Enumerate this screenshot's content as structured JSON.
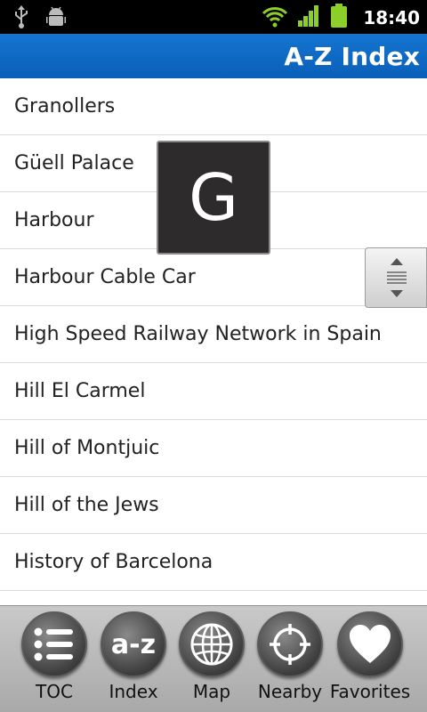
{
  "status_bar": {
    "time": "18:40",
    "icons": [
      "usb-icon",
      "android-debug-icon",
      "wifi-icon",
      "signal-icon",
      "battery-icon"
    ]
  },
  "title_bar": {
    "title": "A-Z Index"
  },
  "list": {
    "items": [
      "Granollers",
      "Güell Palace",
      "Harbour",
      "Harbour Cable Car",
      "High Speed Railway Network in Spain",
      "Hill El Carmel",
      "Hill of Montjuic",
      "Hill of the Jews",
      "History of Barcelona"
    ]
  },
  "fast_scroll": {
    "current_letter": "G"
  },
  "toolbar": {
    "items": [
      {
        "label": "TOC",
        "icon": "list-icon"
      },
      {
        "label": "Index",
        "icon": "a-z-icon",
        "icon_text": "a-z"
      },
      {
        "label": "Map",
        "icon": "globe-icon"
      },
      {
        "label": "Nearby",
        "icon": "crosshair-icon"
      },
      {
        "label": "Favorites",
        "icon": "heart-icon"
      }
    ]
  },
  "colors": {
    "title_bar": "#0a5fb8",
    "status_bar": "#000000",
    "toolbar": "#b8b8b8",
    "signal_green": "#8ccf2a"
  }
}
